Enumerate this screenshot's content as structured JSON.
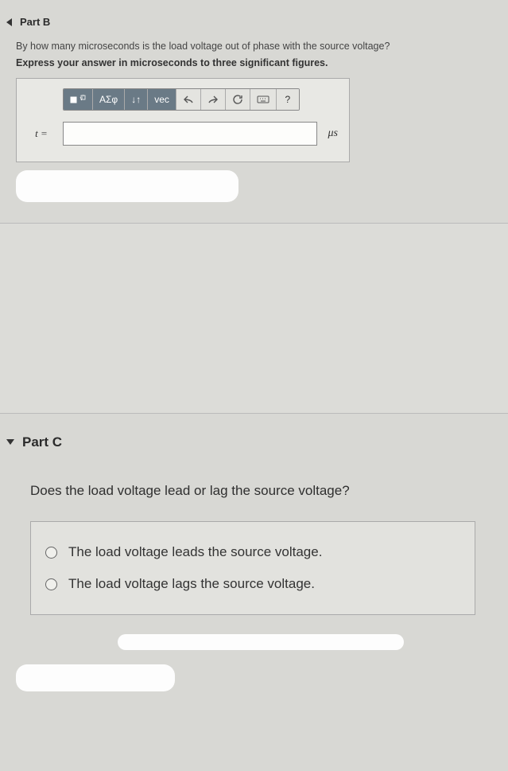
{
  "partB": {
    "title": "Part B",
    "question": "By how many microseconds is the load voltage out of phase with the source voltage?",
    "instruction": "Express your answer in microseconds to three significant figures.",
    "toolbar": {
      "symbols": "ΑΣφ",
      "subsup": "↓↑",
      "vec": "vec",
      "help": "?"
    },
    "variable": "t =",
    "unit": "μs"
  },
  "partC": {
    "title": "Part C",
    "question": "Does the load voltage lead or lag the source voltage?",
    "options": [
      "The load voltage leads the source voltage.",
      "The load voltage lags the source voltage."
    ]
  }
}
